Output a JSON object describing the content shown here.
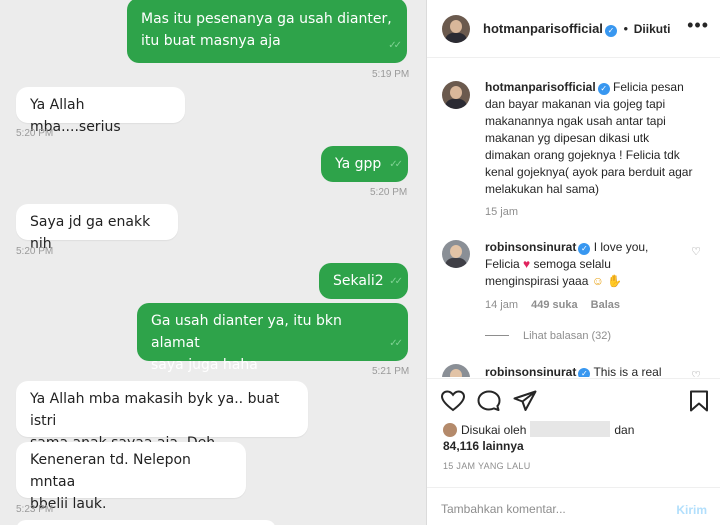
{
  "chat": {
    "messages": [
      {
        "text": "Mas itu pesenanya ga usah dianter,\nitu buat masnya aja",
        "time": "5:19 PM",
        "dir": "out"
      },
      {
        "text": "Ya Allah mba....serius",
        "time": "5:20 PM",
        "dir": "in"
      },
      {
        "text": "Ya gpp",
        "time": "5:20 PM",
        "dir": "out"
      },
      {
        "text": "Saya jd ga enakk nih",
        "time": "5:20 PM",
        "dir": "in"
      },
      {
        "text": "Sekali2",
        "time": "",
        "dir": "out"
      },
      {
        "text": "Ga usah dianter ya, itu bkn alamat\nsaya juga haha",
        "time": "5:21 PM",
        "dir": "out"
      },
      {
        "text": "Ya Allah mba makasih byk ya.. buat istri\nsama anak sayaa aja. Deh",
        "time": "",
        "dir": "in"
      },
      {
        "text": "Keneneran td. Nelepon mntaa\nbbelii lauk.",
        "time": "5:23 PM",
        "dir": "in"
      }
    ]
  },
  "ig": {
    "header": {
      "username": "hotmanparisofficial",
      "separator": "•",
      "follow_status": "Diikuti",
      "more": "•••"
    },
    "caption": {
      "username": "hotmanparisofficial",
      "text": "Felicia pesan dan bayar makanan via gojeg tapi makanannya ngak usah antar tapi makanan yg dipesan dikasi utk dimakan orang gojeknya ! Felicia tdk kenal gojeknya( ayok para berduit agar melakukan hal sama)",
      "age": "15 jam"
    },
    "comments": [
      {
        "username": "robinsonsinurat",
        "text_a": "I love you, Felicia",
        "text_b": "semoga selalu menginspirasi yaaa",
        "age": "14 jam",
        "likes": "449 suka",
        "reply": "Balas",
        "view_replies": "Lihat balasan (32)"
      },
      {
        "username": "robinsonsinurat",
        "text_a": "This is a real"
      }
    ],
    "likes": {
      "prefix": "Disukai oleh",
      "conj": "dan",
      "count": "84,116 lainnya"
    },
    "timestamp": "15 JAM YANG LALU",
    "add_comment": {
      "placeholder": "Tambahkan komentar...",
      "post": "Kirim"
    },
    "colors": {
      "verified": "#3897f0",
      "chat_outgoing": "#2ea34a",
      "post_disabled": "#b2dffc"
    }
  }
}
